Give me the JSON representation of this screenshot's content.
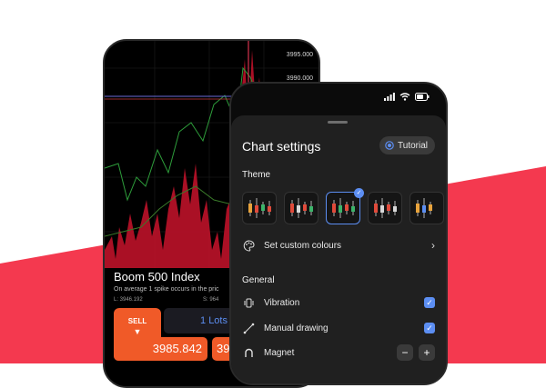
{
  "colors": {
    "accent_red": "#f4394f",
    "accent_blue": "#5c8ef2",
    "orange": "#f05a28"
  },
  "back_phone": {
    "price_labels": [
      "3995.000",
      "3990.000"
    ],
    "asset_name": "Boom 500 Index",
    "asset_desc": "On average 1 spike occurs in the pric",
    "low_label": "L: 3946.192",
    "spread_label": "S: 964",
    "sell_label": "SELL",
    "lots_text": "1 Lots",
    "sell_price": "3985.842",
    "buy_price_partial": "398"
  },
  "front_phone": {
    "sheet_title": "Chart settings",
    "tutorial_label": "Tutorial",
    "theme_label": "Theme",
    "themes": [
      {
        "name": "theme-1",
        "selected": false
      },
      {
        "name": "theme-2",
        "selected": false
      },
      {
        "name": "theme-3",
        "selected": true
      },
      {
        "name": "theme-4",
        "selected": false
      },
      {
        "name": "theme-5",
        "selected": false
      }
    ],
    "custom_colours_label": "Set custom colours",
    "general_label": "General",
    "settings": [
      {
        "label": "Vibration",
        "icon": "vibration-icon",
        "checked": true
      },
      {
        "label": "Manual drawing",
        "icon": "drawing-icon",
        "checked": true
      },
      {
        "label": "Magnet",
        "icon": "magnet-icon",
        "stepper": true
      }
    ],
    "stepper_minus": "−",
    "stepper_plus": "+"
  }
}
